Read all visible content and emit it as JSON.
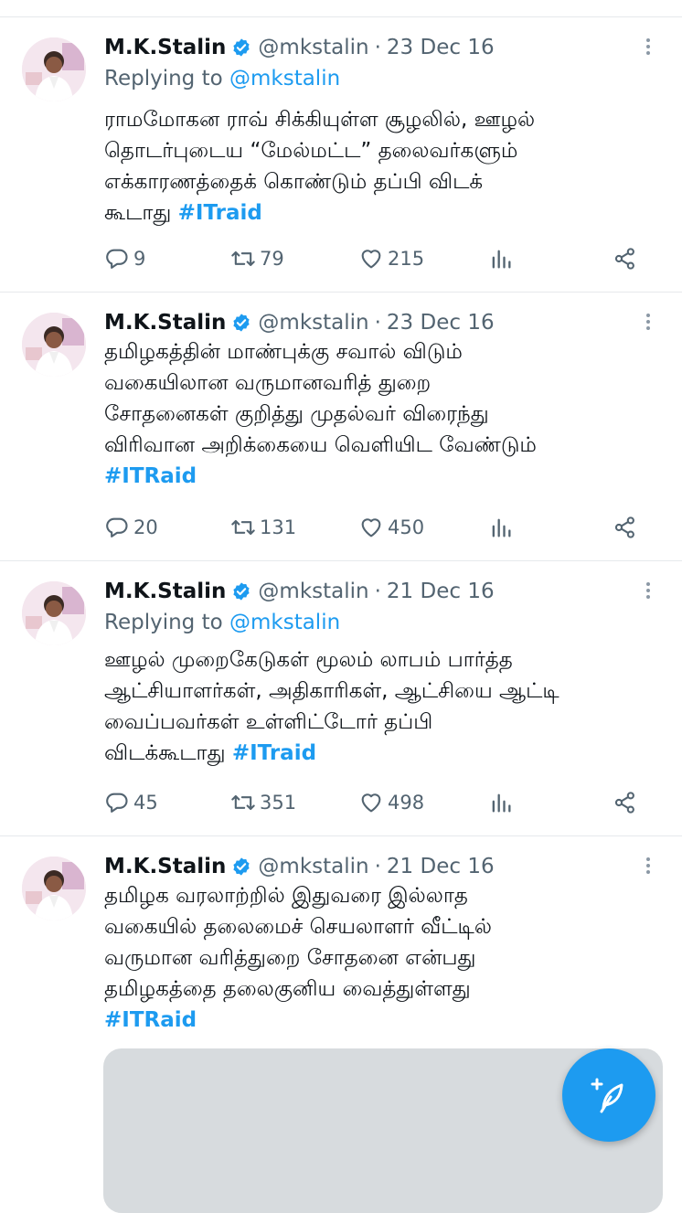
{
  "tweets": [
    {
      "name": "M.K.Stalin",
      "handle": "@mkstalin",
      "dot": "·",
      "date": "23 Dec 16",
      "replying_prefix": "Replying to ",
      "replying_to": "@mkstalin",
      "lines": [
        "ராமமோகன ராவ் சிக்கியுள்ள சூழலில், ஊழல்",
        "தொடர்புடைய “மேல்மட்ட” தலைவர்களும்",
        "எக்காரணத்தைக் கொண்டும் தப்பி விடக்",
        "கூடாது "
      ],
      "hashtag": "#ITraid",
      "replies": "9",
      "retweets": "79",
      "likes": "215"
    },
    {
      "name": "M.K.Stalin",
      "handle": "@mkstalin",
      "dot": "·",
      "date": "23 Dec 16",
      "lines": [
        "தமிழகத்தின் மாண்புக்கு சவால் விடும்",
        "வகையிலான வருமானவரித் துறை",
        "சோதனைகள் குறித்து முதல்வர் விரைந்து",
        "விரிவான அறிக்கையை வெளியிட வேண்டும்"
      ],
      "hashtag": "#ITRaid",
      "replies": "20",
      "retweets": "131",
      "likes": "450"
    },
    {
      "name": "M.K.Stalin",
      "handle": "@mkstalin",
      "dot": "·",
      "date": "21 Dec 16",
      "replying_prefix": "Replying to ",
      "replying_to": "@mkstalin",
      "lines": [
        "ஊழல் முறைகேடுகள் மூலம் லாபம் பார்த்த",
        "ஆட்சியாளர்கள், அதிகாரிகள், ஆட்சியை ஆட்டி",
        "வைப்பவர்கள் உள்ளிட்டோர் தப்பி",
        "விடக்கூடாது "
      ],
      "hashtag": "#ITraid",
      "replies": "45",
      "retweets": "351",
      "likes": "498"
    },
    {
      "name": "M.K.Stalin",
      "handle": "@mkstalin",
      "dot": "·",
      "date": "21 Dec 16",
      "lines": [
        "தமிழக வரலாற்றில் இதுவரை இல்லாத",
        "வகையில் தலைமைச் செயலாளர் வீட்டில்",
        "வருமான வரித்துறை சோதனை என்பது",
        "தமிழகத்தை தலைகுனிய வைத்துள்ளது"
      ],
      "hashtag": "#ITRaid"
    }
  ],
  "colors": {
    "accent": "#1d9bf0",
    "secondary_text": "#536471",
    "divider": "#e6e9ec"
  }
}
